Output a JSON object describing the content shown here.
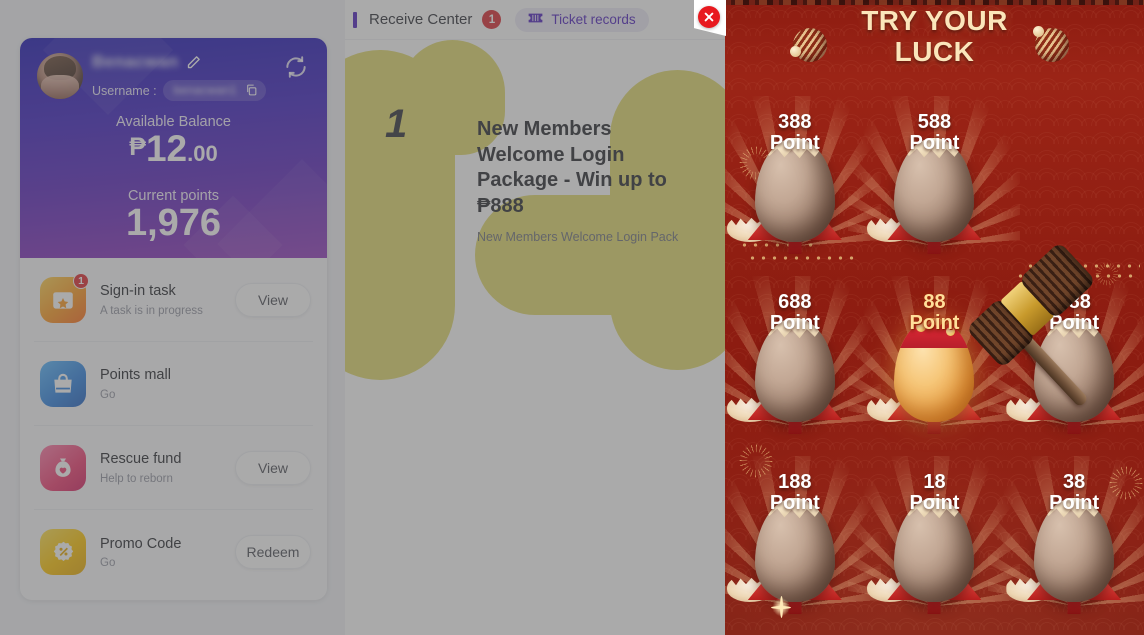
{
  "profile": {
    "nickname": "Benacwan",
    "username_label": "Username :",
    "username_value": "benacwan1",
    "balance_label": "Available Balance",
    "currency_symbol": "₱",
    "balance_int": "12",
    "balance_dec": ".00",
    "points_label": "Current points",
    "points_value": "1,976",
    "edit_icon": "pencil-icon",
    "copy_icon": "copy-icon",
    "refresh_icon": "refresh-icon",
    "avatar_icon": "avatar"
  },
  "tasks": [
    {
      "id": "sign-in-task",
      "title": "Sign-in task",
      "subtitle": "A task is in progress",
      "badge": "1",
      "button": "View",
      "has_button": true,
      "icon": "calendar-star-icon"
    },
    {
      "id": "points-mall",
      "title": "Points mall",
      "subtitle": "Go",
      "badge": "",
      "button": "",
      "has_button": false,
      "icon": "shopping-bag-icon"
    },
    {
      "id": "rescue-fund",
      "title": "Rescue fund",
      "subtitle": "Help to reborn",
      "badge": "",
      "button": "View",
      "has_button": true,
      "icon": "money-bag-heart-icon"
    },
    {
      "id": "promo-code",
      "title": "Promo Code",
      "subtitle": "Go",
      "badge": "",
      "button": "Redeem",
      "has_button": true,
      "icon": "percent-badge-icon"
    }
  ],
  "receive_center": {
    "title": "Receive Center",
    "badge": "1",
    "ticket_records_label": "Ticket records",
    "ticket_icon": "ticket-icon",
    "accent_color": "#4b1fbe",
    "badge_color": "#d9272e"
  },
  "promo": {
    "number": "1",
    "title": "New Members Welcome Login Package - Win up to ₱888",
    "subtitle": "New Members Welcome Login Pack"
  },
  "luck": {
    "title_line1": "TRY YOUR",
    "title_line2": "LUCK",
    "panel_color": "#8d1c11",
    "title_color": "#fbe6bb",
    "eggs": [
      {
        "value": "388",
        "unit": "Point",
        "active": false
      },
      {
        "value": "588",
        "unit": "Point",
        "active": false
      },
      {
        "value": "",
        "unit": "",
        "active": false,
        "empty": true
      },
      {
        "value": "688",
        "unit": "Point",
        "active": false
      },
      {
        "value": "88",
        "unit": "Point",
        "active": true
      },
      {
        "value": "888",
        "unit": "Point",
        "active": false
      },
      {
        "value": "188",
        "unit": "Point",
        "active": false
      },
      {
        "value": "18",
        "unit": "Point",
        "active": false
      },
      {
        "value": "38",
        "unit": "Point",
        "active": false
      }
    ],
    "hammer_icon": "hammer-icon"
  },
  "close": {
    "icon": "close-icon",
    "color": "#e8191f"
  }
}
